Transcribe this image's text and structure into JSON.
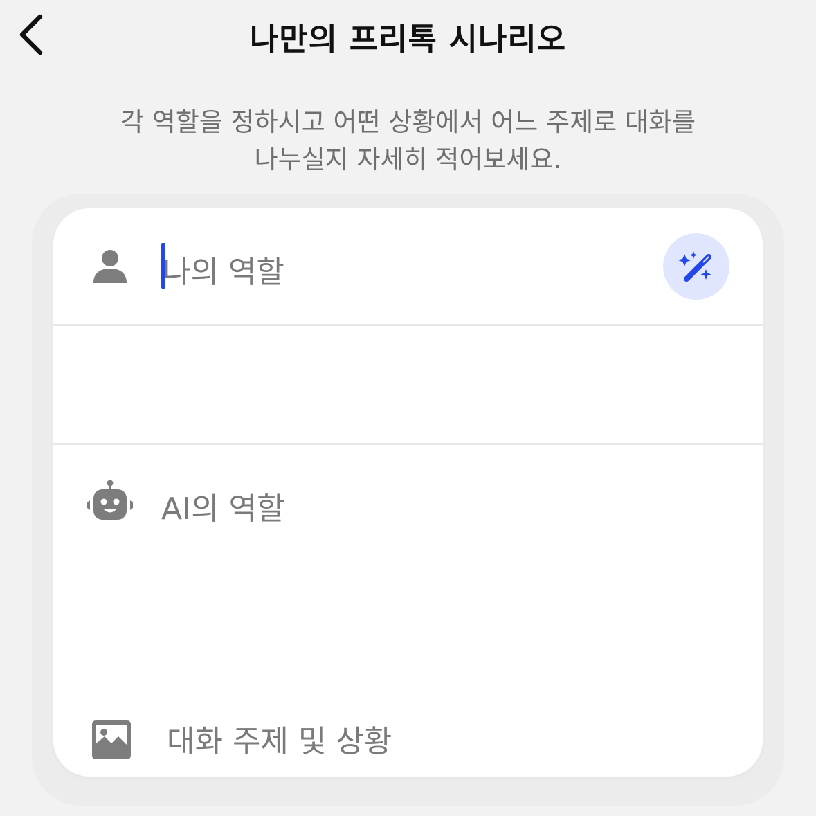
{
  "header": {
    "title": "나만의 프리톡 시나리오",
    "back_icon": "chevron-left-icon"
  },
  "instructions": {
    "line1": "각 역할을 정하시고 어떤 상황에서 어느 주제로 대화를",
    "line2": "나누실지 자세히 적어보세요."
  },
  "form": {
    "my_role": {
      "icon": "person-icon",
      "placeholder": "나의 역할",
      "value": ""
    },
    "ai_role": {
      "icon": "robot-icon",
      "placeholder": "AI의 역할",
      "value": ""
    },
    "topic": {
      "icon": "image-icon",
      "placeholder": "대화 주제 및 상황",
      "value": ""
    },
    "magic_button": {
      "icon": "magic-wand-icon"
    }
  },
  "colors": {
    "background": "#f2f2f2",
    "card": "#ffffff",
    "accent": "#2348e8",
    "accent_soft": "#dfe6fd",
    "placeholder": "#7a7a7a",
    "icon": "#7d7d7d"
  }
}
